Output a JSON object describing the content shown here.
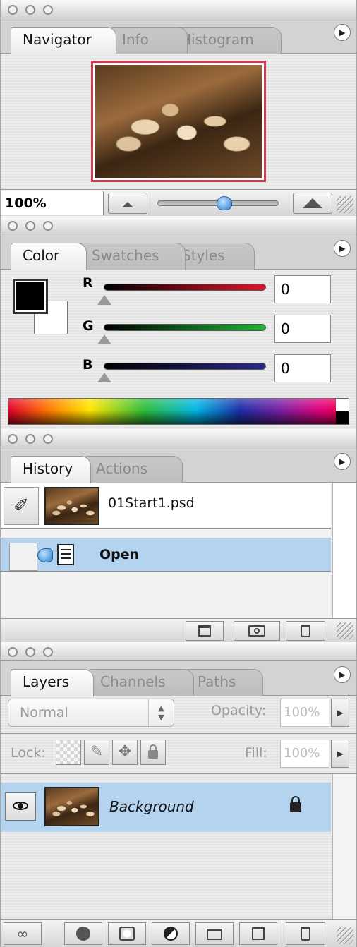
{
  "navigator": {
    "tabs": [
      {
        "label": "Navigator"
      },
      {
        "label": "Info"
      },
      {
        "label": "Histogram"
      }
    ],
    "zoom_value": "100%",
    "zoom_slider_level": 0.55
  },
  "color": {
    "tabs": [
      {
        "label": "Color"
      },
      {
        "label": "Swatches"
      },
      {
        "label": "Styles"
      }
    ],
    "foreground": "#000000",
    "background": "#ffffff",
    "channels": [
      {
        "label": "R",
        "value": "0",
        "color": "#e0162b"
      },
      {
        "label": "G",
        "value": "0",
        "color": "#22b33a"
      },
      {
        "label": "B",
        "value": "0",
        "color": "#2b2a8a"
      }
    ]
  },
  "history": {
    "tabs": [
      {
        "label": "History"
      },
      {
        "label": "Actions"
      }
    ],
    "snapshot_name": "01Start1.psd",
    "items": [
      {
        "label": "Open"
      }
    ]
  },
  "layers": {
    "tabs": [
      {
        "label": "Layers"
      },
      {
        "label": "Channels"
      },
      {
        "label": "Paths"
      }
    ],
    "blend_mode": "Normal",
    "opacity_label": "Opacity:",
    "opacity_value": "100%",
    "lock_label": "Lock:",
    "fill_label": "Fill:",
    "fill_value": "100%",
    "layer_name": "Background"
  },
  "colors": {
    "selected_row": "#b3d3ef",
    "accent_blue": "#3f8fd6"
  }
}
